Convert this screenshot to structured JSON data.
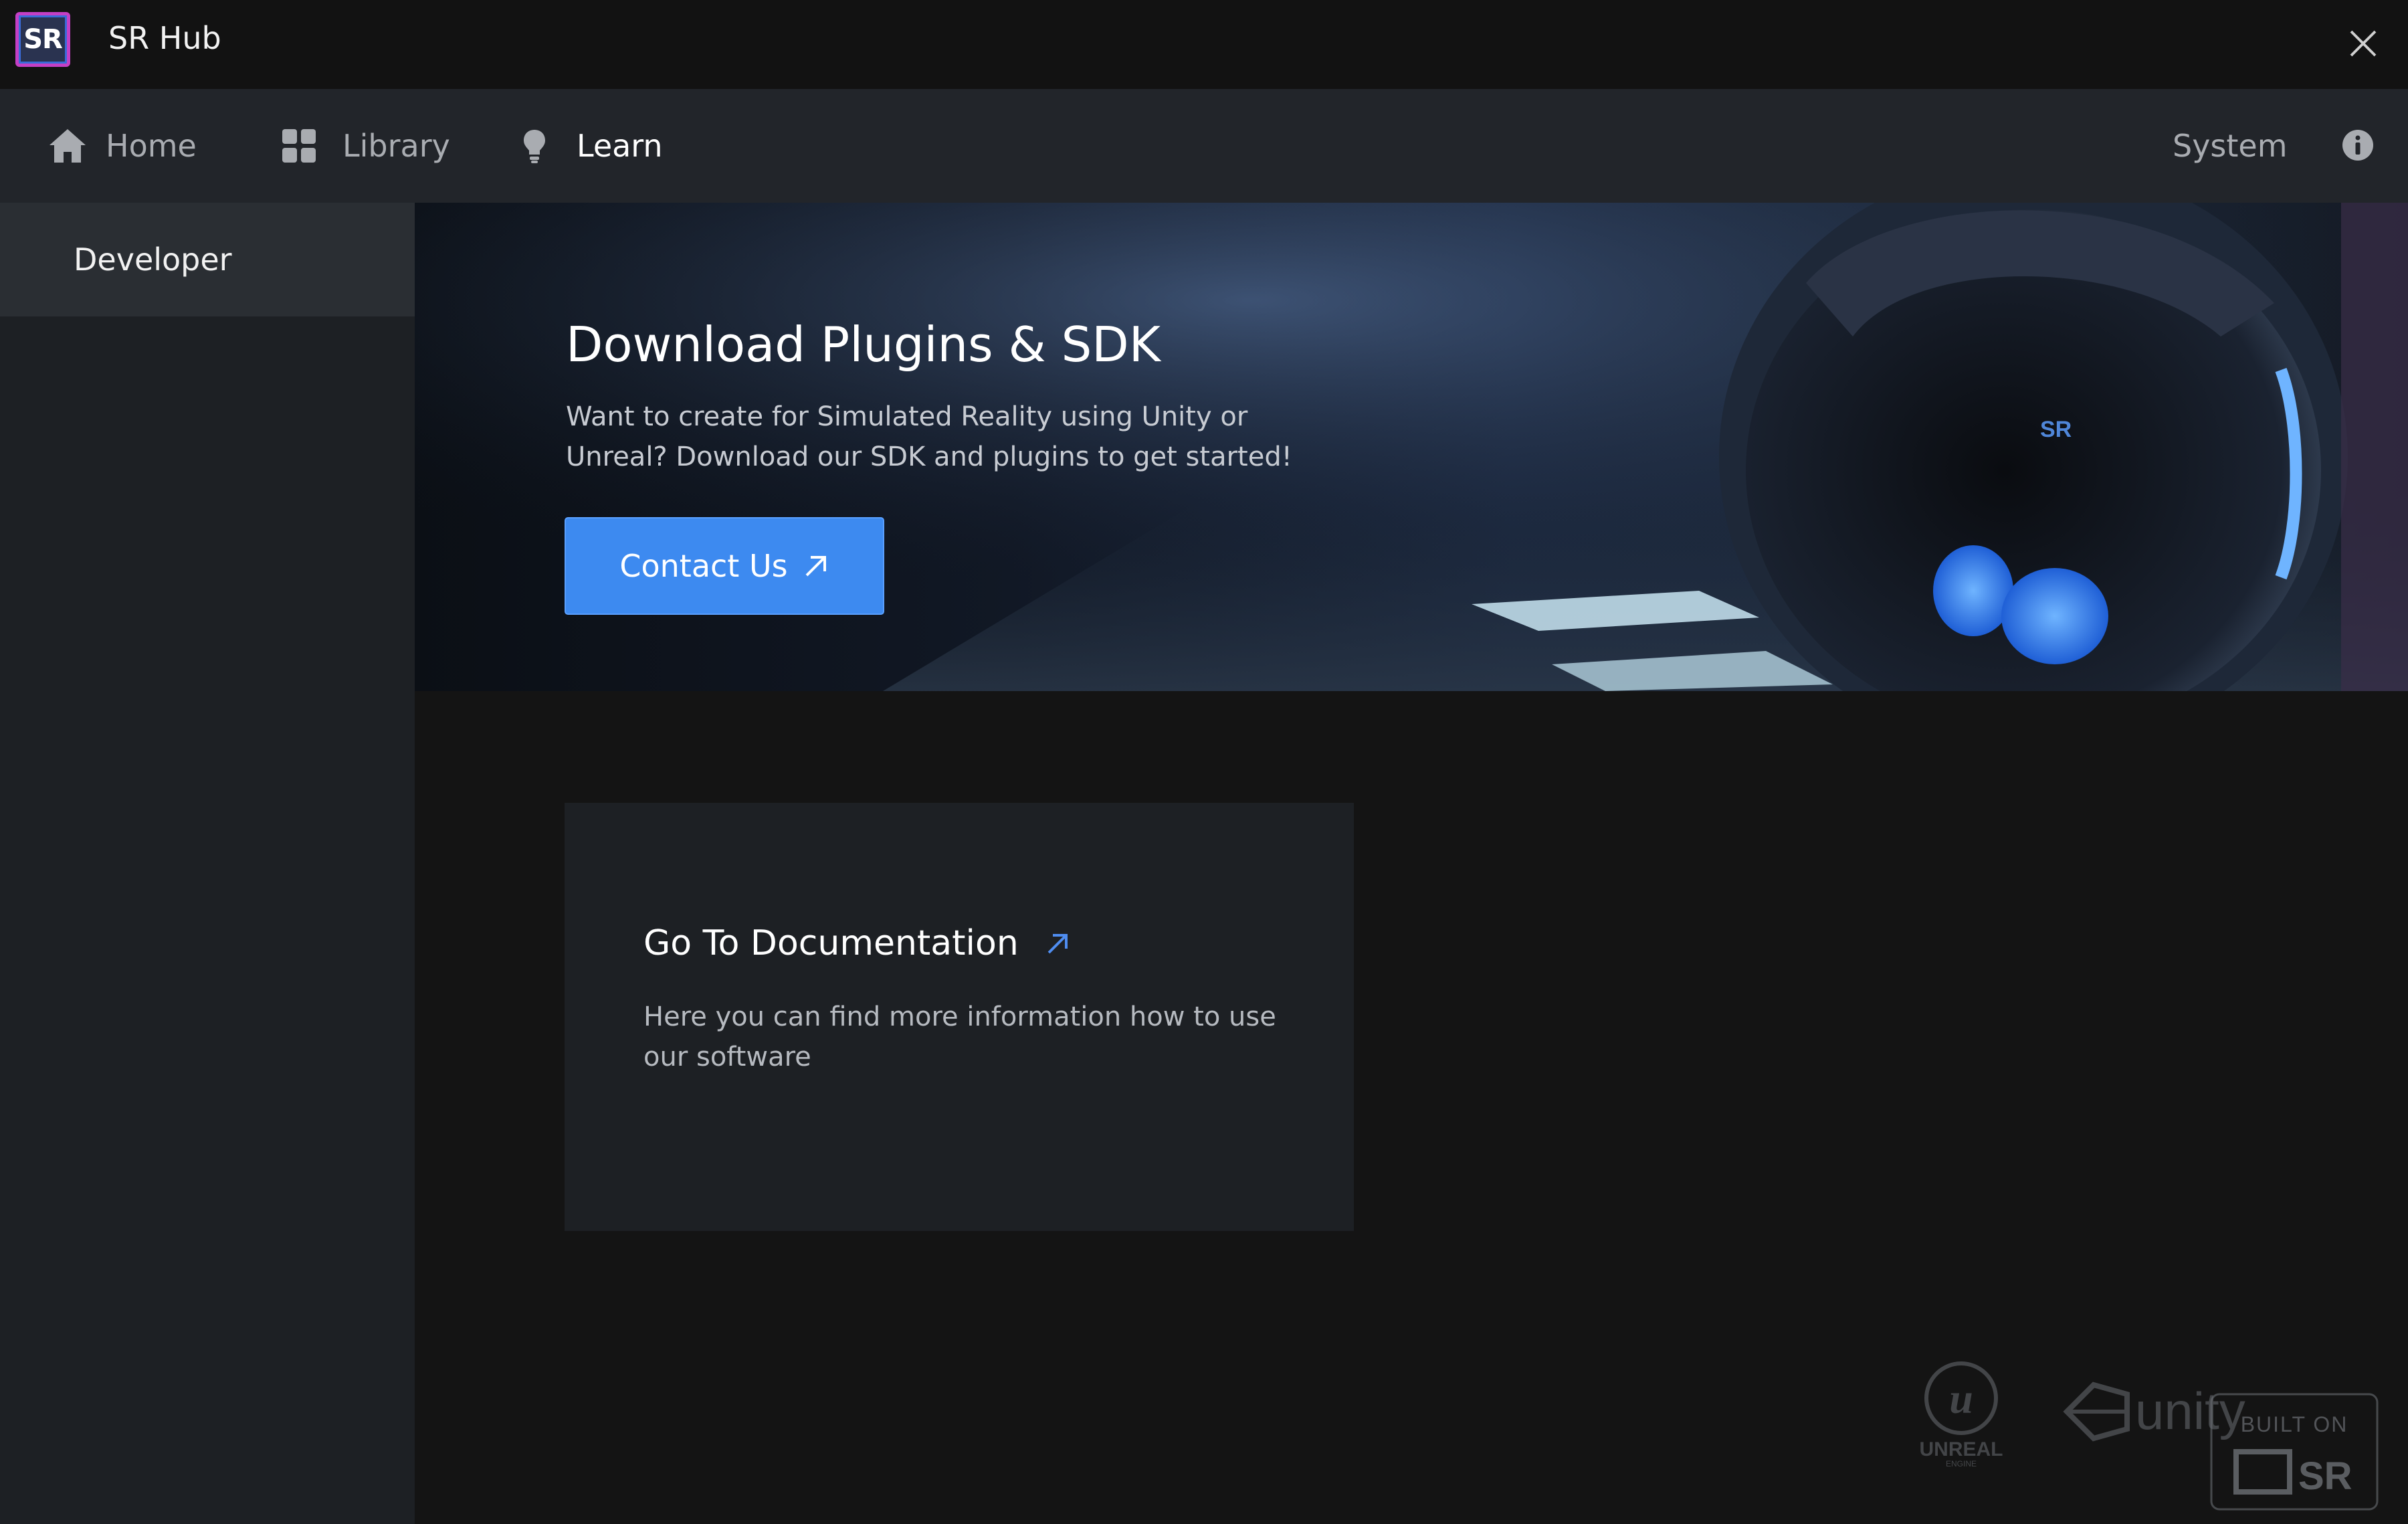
{
  "window": {
    "title": "SR Hub",
    "logo_text": "SR"
  },
  "nav": {
    "items": [
      {
        "label": "Home",
        "icon": "home-icon"
      },
      {
        "label": "Library",
        "icon": "grid-icon"
      },
      {
        "label": "Learn",
        "icon": "lightbulb-icon",
        "active": true
      }
    ],
    "system_label": "System"
  },
  "sidebar": {
    "items": [
      {
        "label": "Developer",
        "active": true
      }
    ]
  },
  "hero": {
    "title": "Download Plugins & SDK",
    "description": "Want to create for Simulated Reality using Unity or Unreal? Download our SDK and plugins to get started!",
    "button_label": "Contact Us",
    "robot_badge": "SR"
  },
  "doc_card": {
    "title": "Go To Documentation",
    "description": "Here you can find more information how to use our software"
  },
  "footer": {
    "unreal_text": "UNREAL",
    "unreal_sub": "ENGINE",
    "unity_text": "unity",
    "built_on_text": "BUILT ON",
    "sr_text": "SR"
  },
  "colors": {
    "accent": "#3d8af0",
    "nav_bg": "#22252a",
    "titlebar_bg": "#121212",
    "sidebar_bg": "#1d2024"
  }
}
